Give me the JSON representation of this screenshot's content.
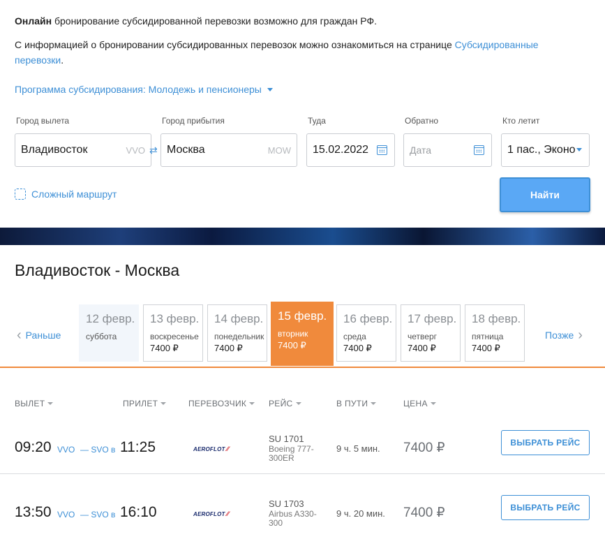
{
  "info": {
    "line1_bold": "Онлайн",
    "line1_rest": " бронирование субсидированной перевозки возможно для граждан РФ.",
    "line2_text": "С информацией о бронировании субсидированных перевозок можно ознакомиться на странице ",
    "line2_link": "Субсидированные перевозки",
    "line2_end": "."
  },
  "program_label": "Программа субсидирования: Молодежь и пенсионеры",
  "form": {
    "from_label": "Город вылета",
    "from_value": "Владивосток",
    "from_code": "VVO",
    "to_label": "Город прибытия",
    "to_value": "Москва",
    "to_code": "MOW",
    "there_label": "Туда",
    "there_value": "15.02.2022",
    "back_label": "Обратно",
    "back_placeholder": "Дата",
    "who_label": "Кто летит",
    "who_value": "1 пас., Эконо",
    "swap_icon": "⇄",
    "complex_route": "Сложный маршрут",
    "find_button": "Найти"
  },
  "route_title": "Владивосток - Москва",
  "date_nav": {
    "earlier": "Раньше",
    "later": "Позже",
    "days": [
      {
        "date": "12 февр.",
        "weekday": "суббота",
        "price": ""
      },
      {
        "date": "13 февр.",
        "weekday": "воскресенье",
        "price": "7400 ₽"
      },
      {
        "date": "14 февр.",
        "weekday": "понедельник",
        "price": "7400 ₽"
      },
      {
        "date": "15 февр.",
        "weekday": "вторник",
        "price": "7400 ₽"
      },
      {
        "date": "16 февр.",
        "weekday": "среда",
        "price": "7400 ₽"
      },
      {
        "date": "17 февр.",
        "weekday": "четверг",
        "price": "7400 ₽"
      },
      {
        "date": "18 февр.",
        "weekday": "пятница",
        "price": "7400 ₽"
      }
    ],
    "active_index": 3
  },
  "table": {
    "headers": [
      "ВЫЛЕТ",
      "ПРИЛЕТ",
      "ПЕРЕВОЗЧИК",
      "РЕЙС",
      "В ПУТИ",
      "ЦЕНА"
    ],
    "rows": [
      {
        "dep_time": "09:20",
        "dep_code": "VVO",
        "arr_code": "— SVO в",
        "arr_time": "11:25",
        "carrier": "AEROFLOT",
        "flight": "SU 1701",
        "aircraft": "Boeing 777-300ER",
        "duration": "9 ч. 5 мин.",
        "price": "7400 ₽",
        "select": "ВЫБРАТЬ РЕЙС"
      },
      {
        "dep_time": "13:50",
        "dep_code": "VVO",
        "arr_code": "— SVO в",
        "arr_time": "16:10",
        "carrier": "AEROFLOT",
        "flight": "SU 1703",
        "aircraft": "Airbus A330-300",
        "duration": "9 ч. 20 мин.",
        "price": "7400 ₽",
        "select": "ВЫБРАТЬ РЕЙС"
      }
    ]
  },
  "colors": {
    "accent": "#3d8fd6",
    "active_date": "#f08a3c",
    "find_button": "#5aa8f5"
  },
  "icons": {
    "calendar": "calendar-icon",
    "swap": "swap-icon",
    "route": "complex-route-icon",
    "caret": "caret-down-icon"
  }
}
